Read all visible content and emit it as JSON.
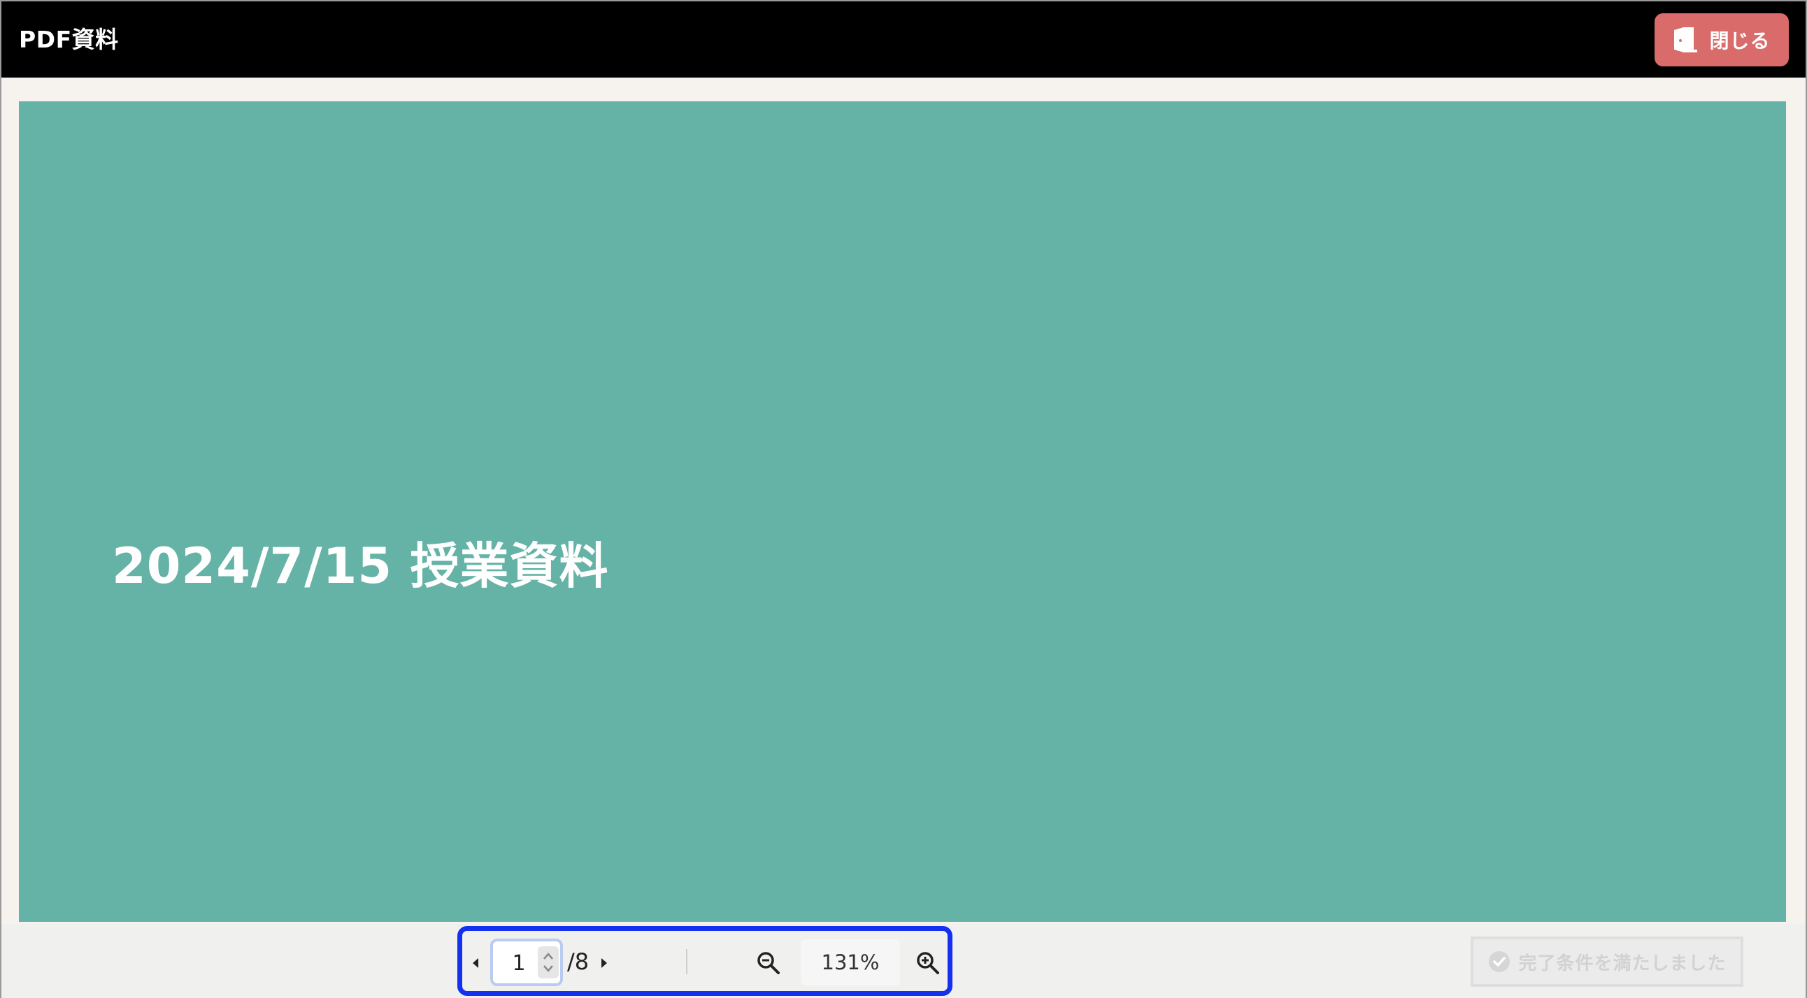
{
  "header": {
    "title": "PDF資料",
    "close_label": "閉じる",
    "close_icon": "door-exit-icon"
  },
  "document": {
    "page_heading": "2024/7/15 授業資料",
    "page_background": "#65b3a6"
  },
  "pager": {
    "current_page": "1",
    "total_pages": "/8",
    "zoom_level": "131%",
    "prev_icon": "triangle-left-icon",
    "next_icon": "triangle-right-icon",
    "zoom_out_icon": "zoom-out-icon",
    "zoom_in_icon": "zoom-in-icon"
  },
  "footer": {
    "complete_label": "完了条件を満たしました",
    "complete_state": "disabled"
  },
  "colors": {
    "header_bg": "#000000",
    "close_button_bg": "#d96b6b",
    "highlight_outline": "#1530ee"
  }
}
